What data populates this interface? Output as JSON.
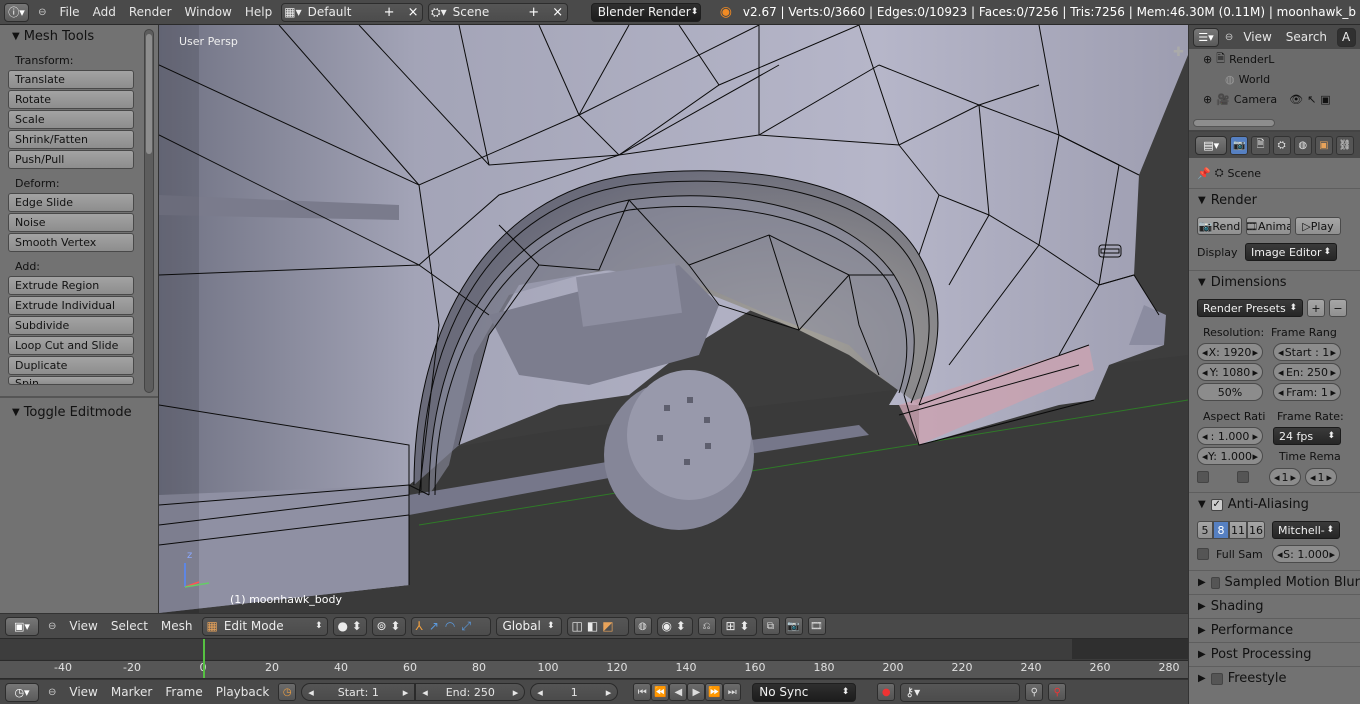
{
  "topbar": {
    "menus": [
      "File",
      "Add",
      "Render",
      "Window",
      "Help"
    ],
    "layout": "Default",
    "scene": "Scene",
    "engine": "Blender Render",
    "stats": "v2.67 | Verts:0/3660 | Edges:0/10923 | Faces:0/7256 | Tris:7256 | Mem:46.30M (0.11M) | moonhawk_b"
  },
  "tools": {
    "title": "Mesh Tools",
    "transform_label": "Transform:",
    "transform": [
      "Translate",
      "Rotate",
      "Scale",
      "Shrink/Fatten",
      "Push/Pull"
    ],
    "deform_label": "Deform:",
    "deform": [
      "Edge Slide",
      "Noise",
      "Smooth Vertex"
    ],
    "add_label": "Add:",
    "add": [
      "Extrude Region",
      "Extrude Individual",
      "Subdivide",
      "Loop Cut and Slide",
      "Duplicate",
      "Spin"
    ],
    "toggle": "Toggle Editmode"
  },
  "viewport": {
    "view_label": "User Persp",
    "object_label": "(1) moonhawk_body",
    "gizmo_z": "z"
  },
  "vp_header": {
    "menus": [
      "View",
      "Select",
      "Mesh"
    ],
    "mode": "Edit Mode",
    "orientation": "Global"
  },
  "timeline": {
    "ticks": [
      "-40",
      "-20",
      "0",
      "20",
      "40",
      "60",
      "80",
      "100",
      "120",
      "140",
      "160",
      "180",
      "200",
      "220",
      "240",
      "260",
      "280"
    ],
    "current_frame": 0
  },
  "tl_header": {
    "menus": [
      "View",
      "Marker",
      "Frame",
      "Playback"
    ],
    "start": "Start: 1",
    "end": "End: 250",
    "frame": "1",
    "sync": "No Sync"
  },
  "outliner": {
    "menus": [
      "View",
      "Search"
    ],
    "corner": "A",
    "items": [
      "RenderL",
      "World",
      "Camera"
    ]
  },
  "properties": {
    "scene": "Scene",
    "render": {
      "title": "Render",
      "render_btn": "Rend",
      "anim_btn": "Anima",
      "play_btn": "Play",
      "display_label": "Display",
      "display": "Image Editor"
    },
    "dimensions": {
      "title": "Dimensions",
      "presets": "Render Presets",
      "resolution_label": "Resolution:",
      "frame_range_label": "Frame Rang",
      "res_x": "X: 1920",
      "res_y": "Y: 1080",
      "res_pct": "50%",
      "start": "Start : 1",
      "end": "En: 250",
      "step": "Fram: 1",
      "aspect_label": "Aspect Rati",
      "frame_rate_label": "Frame Rate:",
      "aspect_x": ": 1.000",
      "aspect_y": "Y: 1.000",
      "fps": "24 fps",
      "time_remap_label": "Time Rema",
      "remap_old": "1",
      "remap_new": "1"
    },
    "aa": {
      "title": "Anti-Aliasing",
      "samples": [
        "5",
        "8",
        "11",
        "16"
      ],
      "selected": "8",
      "filter": "Mitchell-",
      "full_sample": "Full Sam",
      "size": "S: 1.000"
    },
    "collapsed": [
      "Sampled Motion Blur",
      "Shading",
      "Performance",
      "Post Processing",
      "Freestyle"
    ]
  }
}
